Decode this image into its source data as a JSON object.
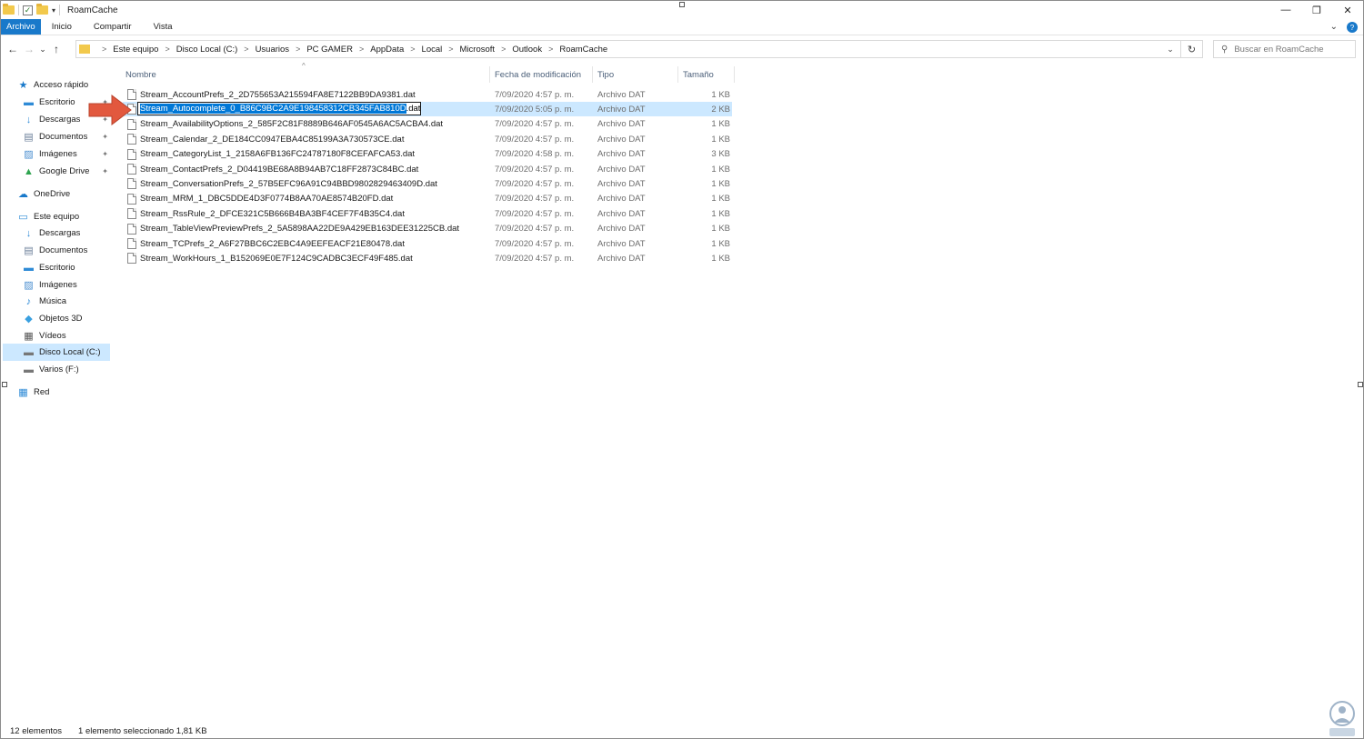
{
  "window": {
    "title": "RoamCache",
    "minimize_glyph": "—",
    "maximize_glyph": "❐",
    "close_glyph": "✕"
  },
  "ribbon": {
    "tabs": [
      "Archivo",
      "Inicio",
      "Compartir",
      "Vista"
    ],
    "expand_glyph": "⌄",
    "help_glyph": "?"
  },
  "nav": {
    "back_glyph": "←",
    "forward_glyph": "→",
    "recent_glyph": "⌄",
    "up_glyph": "↑"
  },
  "address": {
    "crumbs": [
      "Este equipo",
      "Disco Local (C:)",
      "Usuarios",
      "PC GAMER",
      "AppData",
      "Local",
      "Microsoft",
      "Outlook",
      "RoamCache"
    ],
    "separator": ">",
    "dropdown_glyph": "⌄",
    "refresh_glyph": "↻"
  },
  "search": {
    "placeholder": "Buscar en RoamCache",
    "icon_glyph": "⚲"
  },
  "sidebar": {
    "items": [
      {
        "label": "Acceso rápido",
        "icon": "star-icon",
        "glyph": "★",
        "color": "#1979ca",
        "pinned": false
      },
      {
        "label": "Escritorio",
        "icon": "desktop-icon",
        "glyph": "▬",
        "color": "#2f8bd6",
        "pinned": true
      },
      {
        "label": "Descargas",
        "icon": "download-icon",
        "glyph": "↓",
        "color": "#2f8bd6",
        "pinned": true
      },
      {
        "label": "Documentos",
        "icon": "documents-icon",
        "glyph": "▤",
        "color": "#6b7f99",
        "pinned": true
      },
      {
        "label": "Imágenes",
        "icon": "pictures-icon",
        "glyph": "▨",
        "color": "#4b8fd0",
        "pinned": true
      },
      {
        "label": "Google Drive",
        "icon": "google-drive-icon",
        "glyph": "▲",
        "color": "#2ea44f",
        "pinned": true
      },
      {
        "label": "OneDrive",
        "icon": "onedrive-icon",
        "glyph": "☁",
        "color": "#1979ca",
        "pinned": false
      },
      {
        "label": "Este equipo",
        "icon": "computer-icon",
        "glyph": "▭",
        "color": "#2f8bd6",
        "pinned": false
      },
      {
        "label": "Descargas",
        "icon": "download-icon",
        "glyph": "↓",
        "color": "#2f8bd6",
        "pinned": false
      },
      {
        "label": "Documentos",
        "icon": "documents-icon",
        "glyph": "▤",
        "color": "#6b7f99",
        "pinned": false
      },
      {
        "label": "Escritorio",
        "icon": "desktop-icon",
        "glyph": "▬",
        "color": "#2f8bd6",
        "pinned": false
      },
      {
        "label": "Imágenes",
        "icon": "pictures-icon",
        "glyph": "▨",
        "color": "#4b8fd0",
        "pinned": false
      },
      {
        "label": "Música",
        "icon": "music-icon",
        "glyph": "♪",
        "color": "#2f8bd6",
        "pinned": false
      },
      {
        "label": "Objetos 3D",
        "icon": "cube-icon",
        "glyph": "◆",
        "color": "#3aa0e0",
        "pinned": false
      },
      {
        "label": "Vídeos",
        "icon": "video-icon",
        "glyph": "▦",
        "color": "#555",
        "pinned": false
      },
      {
        "label": "Disco Local (C:)",
        "icon": "drive-icon",
        "glyph": "▬",
        "color": "#777",
        "pinned": false,
        "selected": true
      },
      {
        "label": "Varios (F:)",
        "icon": "drive-icon",
        "glyph": "▬",
        "color": "#777",
        "pinned": false
      },
      {
        "label": "Red",
        "icon": "network-icon",
        "glyph": "▦",
        "color": "#2f8bd6",
        "pinned": false
      }
    ],
    "pin_glyph": "📌"
  },
  "columns": {
    "name": "Nombre",
    "date": "Fecha de modificación",
    "type": "Tipo",
    "size": "Tamaño",
    "sort_glyph": "^"
  },
  "files": [
    {
      "name": "Stream_AccountPrefs_2_2D755653A215594FA8E7122BB9DA9381.dat",
      "date": "7/09/2020 4:57 p. m.",
      "type": "Archivo DAT",
      "size": "1 KB"
    },
    {
      "name": "Stream_Autocomplete_0_B86C9BC2A9E198458312CB345FAB810D.dat",
      "date": "7/09/2020 5:05 p. m.",
      "type": "Archivo DAT",
      "size": "2 KB",
      "selected": true,
      "rename_selected": "Stream_Autocomplete_0_B86C9BC2A9E198458312CB345FAB810D",
      "rename_rest": ".dat"
    },
    {
      "name": "Stream_AvailabilityOptions_2_585F2C81F8889B646AF0545A6AC5ACBA4.dat",
      "date": "7/09/2020 4:57 p. m.",
      "type": "Archivo DAT",
      "size": "1 KB"
    },
    {
      "name": "Stream_Calendar_2_DE184CC0947EBA4C85199A3A730573CE.dat",
      "date": "7/09/2020 4:57 p. m.",
      "type": "Archivo DAT",
      "size": "1 KB"
    },
    {
      "name": "Stream_CategoryList_1_2158A6FB136FC24787180F8CEFAFCA53.dat",
      "date": "7/09/2020 4:58 p. m.",
      "type": "Archivo DAT",
      "size": "3 KB"
    },
    {
      "name": "Stream_ContactPrefs_2_D04419BE68A8B94AB7C18FF2873C84BC.dat",
      "date": "7/09/2020 4:57 p. m.",
      "type": "Archivo DAT",
      "size": "1 KB"
    },
    {
      "name": "Stream_ConversationPrefs_2_57B5EFC96A91C94BBD9802829463409D.dat",
      "date": "7/09/2020 4:57 p. m.",
      "type": "Archivo DAT",
      "size": "1 KB"
    },
    {
      "name": "Stream_MRM_1_DBC5DDE4D3F0774B8AA70AE8574B20FD.dat",
      "date": "7/09/2020 4:57 p. m.",
      "type": "Archivo DAT",
      "size": "1 KB"
    },
    {
      "name": "Stream_RssRule_2_DFCE321C5B666B4BA3BF4CEF7F4B35C4.dat",
      "date": "7/09/2020 4:57 p. m.",
      "type": "Archivo DAT",
      "size": "1 KB"
    },
    {
      "name": "Stream_TableViewPreviewPrefs_2_5A5898AA22DE9A429EB163DEE31225CB.dat",
      "date": "7/09/2020 4:57 p. m.",
      "type": "Archivo DAT",
      "size": "1 KB"
    },
    {
      "name": "Stream_TCPrefs_2_A6F27BBC6C2EBC4A9EEFEACF21E80478.dat",
      "date": "7/09/2020 4:57 p. m.",
      "type": "Archivo DAT",
      "size": "1 KB"
    },
    {
      "name": "Stream_WorkHours_1_B152069E0E7F124C9CADBC3ECF49F485.dat",
      "date": "7/09/2020 4:57 p. m.",
      "type": "Archivo DAT",
      "size": "1 KB"
    }
  ],
  "status": {
    "count": "12 elementos",
    "selection": "1 elemento seleccionado  1,81 KB"
  },
  "colors": {
    "accent": "#1979ca",
    "selection": "#cce8ff",
    "arrow": "#e2583e"
  }
}
